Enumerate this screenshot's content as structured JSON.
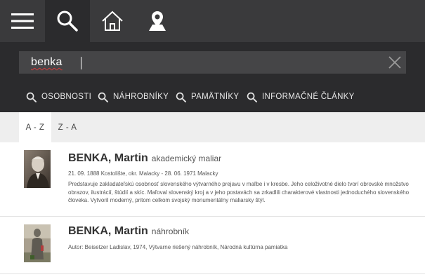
{
  "topbar": {
    "icons": [
      "menu-icon",
      "search-icon",
      "home-icon",
      "map-pin-icon"
    ]
  },
  "search": {
    "value": "benka"
  },
  "filters": [
    {
      "icon": "search-icon",
      "label": "OSOBNOSTI"
    },
    {
      "icon": "search-icon",
      "label": "NÁHROBNÍKY"
    },
    {
      "icon": "search-icon",
      "label": "PAMÄTNÍKY"
    },
    {
      "icon": "search-icon",
      "label": "INFORMAČNÉ ČLÁNKY"
    }
  ],
  "sort": {
    "tabs": [
      {
        "label": "A - Z",
        "active": true
      },
      {
        "label": "Z - A",
        "active": false
      }
    ]
  },
  "results": [
    {
      "name": "BENKA, Martin",
      "type": "akademický maliar",
      "dates": "21. 09. 1888 Kostolište, okr. Malacky - 28. 06. 1971 Malacky",
      "description": "Predstavuje zakladateľskú osobnosť slovenského výtvarného prejavu v maľbe i v kresbe. Jeho celoživotné dielo tvorí obrovské množstvo obrazov, ilustrácií, štúdií a skíc. Maľoval slovenský kroj a v jeho postavách sa zrkadlili charakterové vlastnosti jednoduchého slovenského človeka. Vytvoril moderný, pritom celkom svojský monumentálny maliarsky štýl."
    },
    {
      "name": "BENKA, Martin",
      "type": "náhrobník",
      "dates": "Autor: Beisetzer Ladislav, 1974, Výtvarne riešený náhrobník, Národná kultúrna pamiatka",
      "description": ""
    }
  ],
  "colors": {
    "topbar": "#3a3a3c",
    "panel": "#2b2b2d",
    "search_box": "#454547",
    "sortbar": "#eeeeee"
  }
}
